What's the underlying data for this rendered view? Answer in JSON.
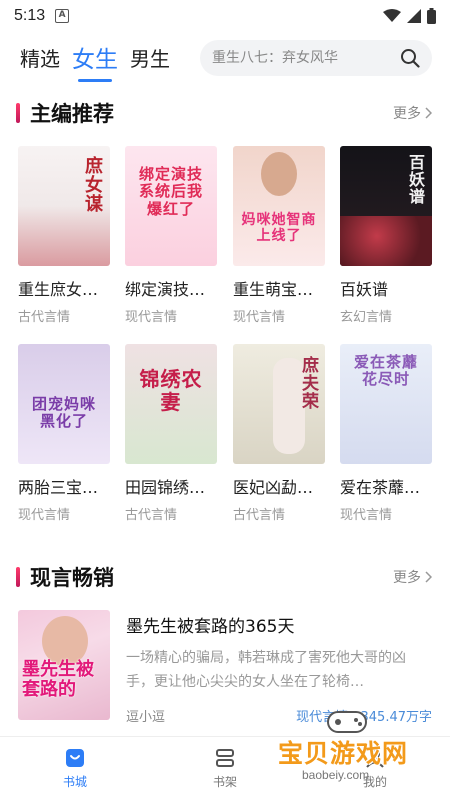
{
  "status_bar": {
    "time": "5:13",
    "notif_letter": "A"
  },
  "nav": {
    "tabs": [
      {
        "label": "精选"
      },
      {
        "label": "女生"
      },
      {
        "label": "男生"
      }
    ],
    "search": {
      "placeholder": "重生八七：弃女风华"
    }
  },
  "section1": {
    "title": "主编推荐",
    "more": "更多",
    "books": [
      {
        "name": "重生庶女…",
        "category": "古代言情",
        "cover_text": "庶女谋",
        "bg": "#f3eeee",
        "text_color": "#b8242e"
      },
      {
        "name": "绑定演技…",
        "category": "现代言情",
        "cover_text": "绑定演技系统后我爆红了",
        "bg": "#fbe7ef",
        "text_color": "#e02b57"
      },
      {
        "name": "重生萌宝…",
        "category": "现代言情",
        "cover_text": "妈咪她智商上线了",
        "bg": "#fce9e6",
        "text_color": "#e6337a"
      },
      {
        "name": "百妖谱",
        "category": "玄幻言情",
        "cover_text": "百妖谱",
        "bg": "#1b1a1e",
        "text_color": "#f2f2f2"
      },
      {
        "name": "两胎三宝…",
        "category": "现代言情",
        "cover_text": "团宠妈咪黑化了",
        "bg": "#e4dbf2",
        "text_color": "#7a3ca8"
      },
      {
        "name": "田园锦绣…",
        "category": "古代言情",
        "cover_text": "锦绣农妻",
        "bg": "#f3e3e6",
        "text_color": "#c51e4a"
      },
      {
        "name": "医妃凶勐…",
        "category": "古代言情",
        "cover_text": "庶夫荣",
        "bg": "#eae7dc",
        "text_color": "#a42d4a"
      },
      {
        "name": "爱在茶蘼…",
        "category": "现代言情",
        "cover_text": "爱在茶蘼花尽时",
        "bg": "#e6eaf6",
        "text_color": "#8a5ab7"
      }
    ]
  },
  "section2": {
    "title": "现言畅销",
    "more": "更多",
    "book": {
      "title": "墨先生被套路的365天",
      "desc": "一场精心的骗局，韩若琳成了害死他大哥的凶手，更让他心尖尖的女人坐在了轮椅…",
      "author": "逗小逗",
      "meta": "现代言情 · 345.47万字",
      "cover_text": "墨先生被套路的"
    }
  },
  "bottom_nav": {
    "items": [
      {
        "label": "书城"
      },
      {
        "label": "书架"
      },
      {
        "label": "我的"
      }
    ]
  },
  "watermark": {
    "text": "宝贝游戏网",
    "url": "baobeiy.com"
  },
  "colors": {
    "accent": "#2d7df6",
    "section_bar": "#e82a63",
    "watermark": "#f39a1a"
  }
}
